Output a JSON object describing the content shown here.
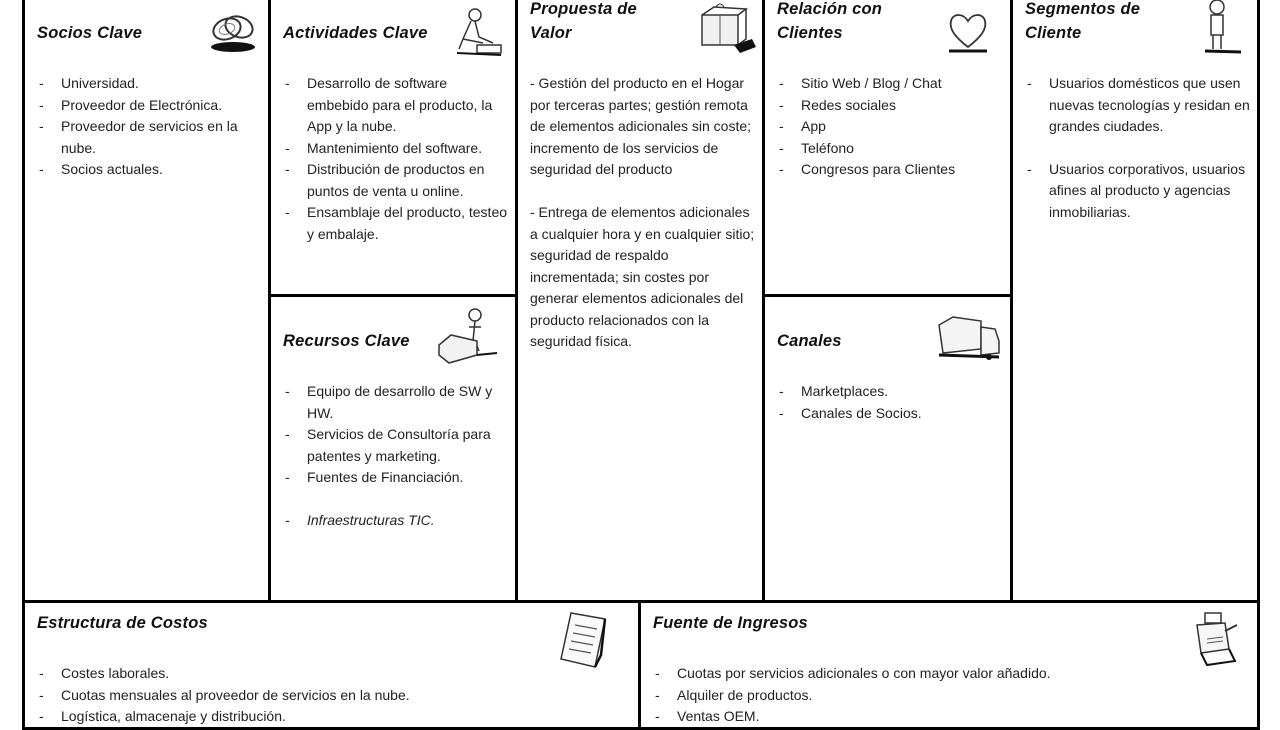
{
  "canvas": {
    "key_partners": {
      "title": "Socios Clave",
      "icon": "chain-links-icon",
      "items": [
        "Universidad.",
        "Proveedor de Electrónica.",
        "Proveedor de servicios en la nube.",
        "Socios actuales."
      ]
    },
    "key_activities": {
      "title": "Actividades Clave",
      "icon": "worker-icon",
      "items": [
        "Desarrollo de software embebido para el producto, la App y la nube.",
        "Mantenimiento del software.",
        "Distribución de productos en puntos de venta u online.",
        "Ensamblaje del producto, testeo y embalaje."
      ]
    },
    "key_resources": {
      "title": "Recursos Clave",
      "icon": "person-with-machine-icon",
      "items": [
        "Equipo de desarrollo de SW y HW.",
        "Servicios de Consultoría para patentes y marketing.",
        "Fuentes de Financiación.",
        "Infraestructuras  TIC."
      ]
    },
    "value_proposition": {
      "title": "Propuesta de Valor",
      "icon": "gift-box-icon",
      "paragraphs": [
        "- Gestión del producto en el Hogar por terceras partes; gestión remota de elementos adicionales sin coste; incremento de los servicios de seguridad del producto",
        "- Entrega de elementos adicionales a cualquier hora y en cualquier sitio; seguridad de respaldo incrementada; sin costes por generar elementos adicionales del producto relacionados con la seguridad física."
      ]
    },
    "customer_relationships": {
      "title": "Relación con Clientes",
      "icon": "heart-icon",
      "items": [
        "Sitio Web / Blog / Chat",
        "Redes sociales",
        "App",
        "Teléfono",
        "Congresos para Clientes"
      ]
    },
    "channels": {
      "title": "Canales",
      "icon": "truck-icon",
      "items": [
        "Marketplaces.",
        "Canales de Socios."
      ]
    },
    "customer_segments": {
      "title": "Segmentos de Cliente",
      "icon": "standing-person-icon",
      "items": [
        "Usuarios domésticos que usen nuevas tecnologías y residan en grandes ciudades.",
        "Usuarios corporativos, usuarios afines al producto y agencias inmobiliarias."
      ]
    },
    "cost_structure": {
      "title": "Estructura de Costos",
      "icon": "receipt-icon",
      "items": [
        "Costes laborales.",
        "Cuotas mensuales al proveedor de servicios en la nube.",
        "Logística, almacenaje y distribución."
      ]
    },
    "revenue_streams": {
      "title": "Fuente de Ingresos",
      "icon": "cash-register-icon",
      "items": [
        "Cuotas por servicios adicionales o con mayor valor añadido.",
        "Alquiler de productos.",
        "Ventas OEM."
      ]
    }
  }
}
